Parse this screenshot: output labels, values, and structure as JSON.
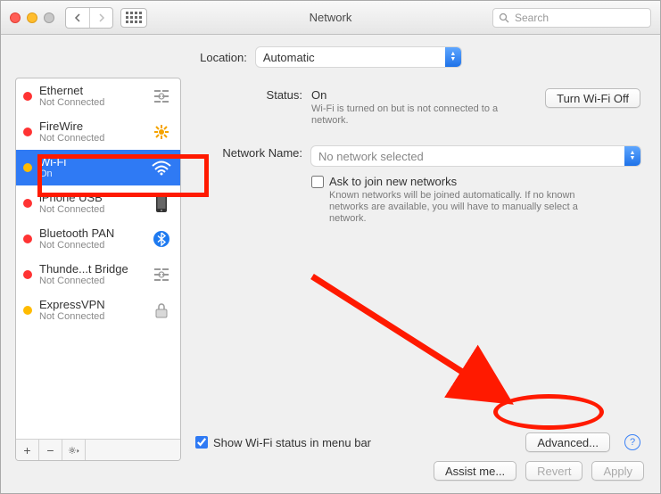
{
  "window": {
    "title": "Network"
  },
  "search": {
    "placeholder": "Search"
  },
  "location": {
    "label": "Location:",
    "value": "Automatic"
  },
  "interfaces": [
    {
      "name": "Ethernet",
      "sub": "Not Connected",
      "dot": "red",
      "icon": "ethernet"
    },
    {
      "name": "FireWire",
      "sub": "Not Connected",
      "dot": "red",
      "icon": "firewire"
    },
    {
      "name": "Wi-Fi",
      "sub": "On",
      "dot": "yellow",
      "icon": "wifi",
      "selected": true
    },
    {
      "name": "iPhone USB",
      "sub": "Not Connected",
      "dot": "red",
      "icon": "phone"
    },
    {
      "name": "Bluetooth PAN",
      "sub": "Not Connected",
      "dot": "red",
      "icon": "bluetooth"
    },
    {
      "name": "Thunde...t Bridge",
      "sub": "Not Connected",
      "dot": "red",
      "icon": "ethernet"
    },
    {
      "name": "ExpressVPN",
      "sub": "Not Connected",
      "dot": "yellow",
      "icon": "lock"
    }
  ],
  "detail": {
    "status_label": "Status:",
    "status_value": "On",
    "status_desc": "Wi-Fi is turned on but is not connected to a network.",
    "wifi_button": "Turn Wi-Fi Off",
    "netname_label": "Network Name:",
    "netname_value": "No network selected",
    "ask_label": "Ask to join new networks",
    "ask_desc": "Known networks will be joined automatically. If no known networks are available, you will have to manually select a network.",
    "show_status_label": "Show Wi-Fi status in menu bar",
    "advanced_button": "Advanced..."
  },
  "footer": {
    "assist": "Assist me...",
    "revert": "Revert",
    "apply": "Apply"
  },
  "annotations": {
    "highlight_rect": "wifi-sidebar-selection",
    "highlight_oval": "advanced-button",
    "arrow": "points-to-advanced"
  }
}
